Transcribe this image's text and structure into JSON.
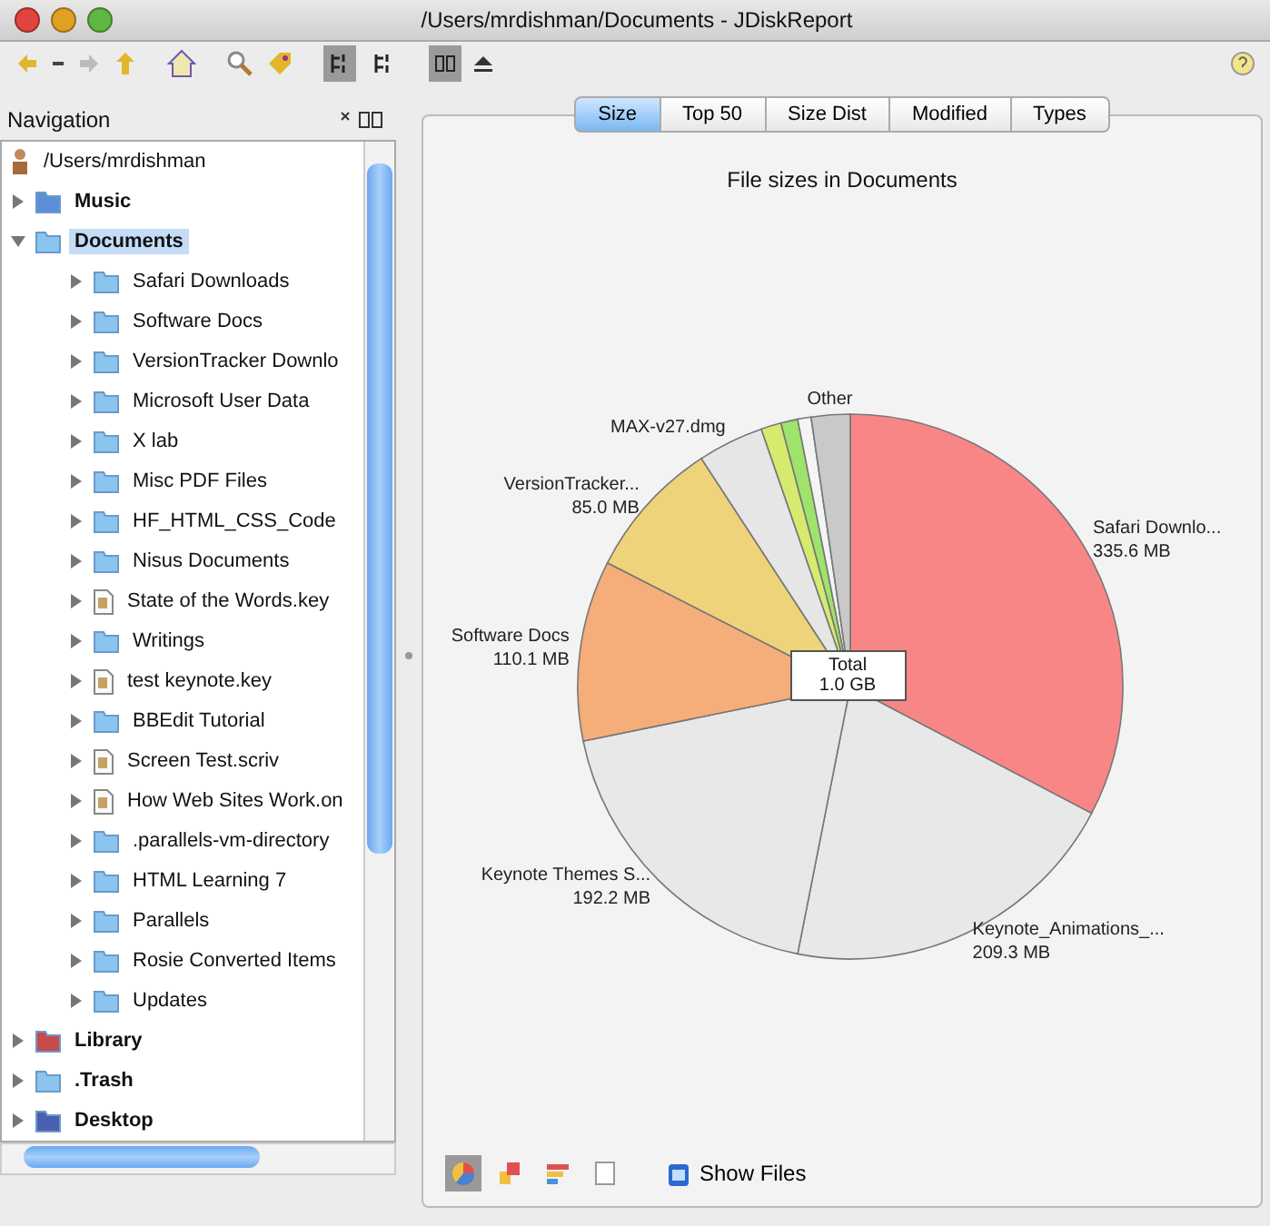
{
  "window": {
    "title": "/Users/mrdishman/Documents - JDiskReport"
  },
  "toolbar": {
    "view_buttons": [
      {
        "selected": true
      },
      {
        "selected": false
      }
    ],
    "size_buttons": [
      {
        "selected": true
      }
    ]
  },
  "navigation": {
    "title": "Navigation",
    "tree": {
      "label": "/Users/mrdishman",
      "children": [
        {
          "label": "Music",
          "kind": "music",
          "expanded": false,
          "selected": false
        },
        {
          "label": "Documents",
          "kind": "folder",
          "expanded": true,
          "selected": true,
          "children": [
            {
              "label": "Safari Downloads",
              "kind": "folder",
              "expanded": false,
              "selected": false
            },
            {
              "label": "Software Docs",
              "kind": "folder",
              "expanded": false,
              "selected": false
            },
            {
              "label": "VersionTracker Downlo",
              "kind": "folder",
              "expanded": false,
              "selected": false
            },
            {
              "label": "Microsoft User Data",
              "kind": "folder",
              "expanded": false,
              "selected": false
            },
            {
              "label": "X lab",
              "kind": "folder",
              "expanded": false,
              "selected": false
            },
            {
              "label": "Misc PDF Files",
              "kind": "folder",
              "expanded": false,
              "selected": false
            },
            {
              "label": "HF_HTML_CSS_Code",
              "kind": "folder",
              "expanded": false,
              "selected": false
            },
            {
              "label": "Nisus Documents",
              "kind": "folder",
              "expanded": false,
              "selected": false
            },
            {
              "label": "State of the Words.key",
              "kind": "document",
              "expanded": false,
              "selected": false
            },
            {
              "label": "Writings",
              "kind": "folder",
              "expanded": false,
              "selected": false
            },
            {
              "label": "test keynote.key",
              "kind": "document",
              "expanded": false,
              "selected": false
            },
            {
              "label": "BBEdit Tutorial",
              "kind": "folder",
              "expanded": false,
              "selected": false
            },
            {
              "label": "Screen Test.scriv",
              "kind": "document",
              "expanded": false,
              "selected": false
            },
            {
              "label": "How Web Sites Work.on",
              "kind": "document",
              "expanded": false,
              "selected": false
            },
            {
              "label": ".parallels-vm-directory",
              "kind": "folder",
              "expanded": false,
              "selected": false
            },
            {
              "label": "HTML Learning 7",
              "kind": "folder",
              "expanded": false,
              "selected": false
            },
            {
              "label": "Parallels",
              "kind": "folder",
              "expanded": false,
              "selected": false
            },
            {
              "label": "Rosie Converted Items",
              "kind": "folder",
              "expanded": false,
              "selected": false
            },
            {
              "label": "Updates",
              "kind": "folder",
              "expanded": false,
              "selected": false
            }
          ]
        },
        {
          "label": "Library",
          "kind": "library",
          "expanded": false,
          "selected": false
        },
        {
          "label": ".Trash",
          "kind": "folder",
          "expanded": false,
          "selected": false
        },
        {
          "label": "Desktop",
          "kind": "desktop",
          "expanded": false,
          "selected": false
        }
      ]
    }
  },
  "tabs": [
    {
      "label": "Size",
      "selected": true
    },
    {
      "label": "Top 50",
      "selected": false
    },
    {
      "label": "Size Dist",
      "selected": false
    },
    {
      "label": "Modified",
      "selected": false
    },
    {
      "label": "Types",
      "selected": false
    }
  ],
  "chart_data": {
    "type": "pie",
    "title": "File sizes in Documents",
    "categories": [
      "Safari Downlo...",
      "Keynote_Animations_...",
      "Keynote Themes S...",
      "Software Docs",
      "VersionTracker...",
      "MAX-v27.dmg",
      null,
      null,
      null,
      "Other"
    ],
    "series": [
      {
        "values": [
          32.7,
          20.4,
          18.7,
          10.7,
          8.3,
          3.9,
          1.2,
          1.0,
          0.8,
          2.3
        ],
        "colors": [
          "#f98686",
          "#e8e8e8",
          "#e8e8e8",
          "#f5ad7a",
          "#eed37a",
          "#e6e6e6",
          "#d6ea70",
          "#9ee36a",
          "#f4f4f4",
          "#c9c9c9"
        ]
      }
    ],
    "value_labels": [
      "335.6 MB",
      "209.3 MB",
      "192.2 MB",
      "110.1 MB",
      "85.0 MB",
      null,
      null,
      null,
      null,
      null
    ]
  },
  "total": {
    "label": "Total",
    "value": "1.0 GB"
  },
  "chart_modes": [
    {
      "selected": true
    },
    {
      "selected": false
    },
    {
      "selected": false
    },
    {
      "selected": false
    }
  ],
  "show_files": {
    "label": "Show Files"
  }
}
